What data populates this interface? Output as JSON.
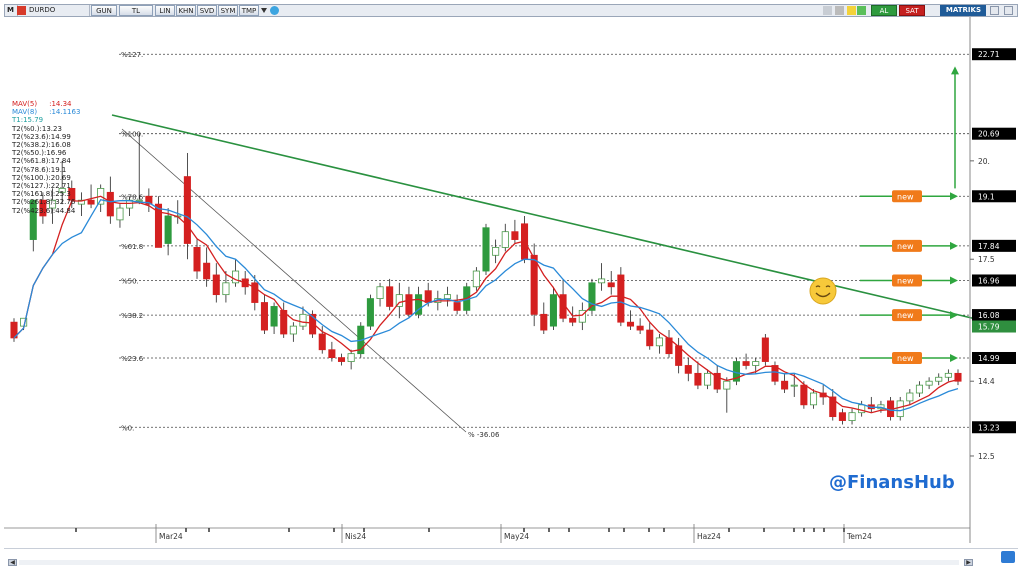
{
  "toolbar": {
    "app_letter": "M",
    "symbol": "DURDO",
    "buttons": [
      "GUN",
      "TL",
      "LIN",
      "KHN",
      "SVD",
      "SYM",
      "TMP"
    ],
    "buy_label": "AL",
    "sell_label": "SAT",
    "brand": "MATRIKS"
  },
  "indicators": [
    {
      "label": "MAV(5)",
      "value": ":14.34",
      "color": "#d42020"
    },
    {
      "label": "MAV(8)",
      "value": ":14.1163",
      "color": "#2a8ad8"
    },
    {
      "label": "T1:15.79",
      "value": "",
      "color": "#20a0a0"
    },
    {
      "label": "T2(%0.):13.23",
      "value": "",
      "color": "#222222"
    },
    {
      "label": "T2(%23.6):14.99",
      "value": "",
      "color": "#222222"
    },
    {
      "label": "T2(%38.2):16.08",
      "value": "",
      "color": "#222222"
    },
    {
      "label": "T2(%50.):16.96",
      "value": "",
      "color": "#222222"
    },
    {
      "label": "T2(%61.8):17.84",
      "value": "",
      "color": "#222222"
    },
    {
      "label": "T2(%78.6):19.1",
      "value": "",
      "color": "#222222"
    },
    {
      "label": "T2(%100.):20.69",
      "value": "",
      "color": "#222222"
    },
    {
      "label": "T2(%127.):22.71",
      "value": "",
      "color": "#222222"
    },
    {
      "label": "T2(%161.8):25.3",
      "value": "",
      "color": "#222222"
    },
    {
      "label": "T2(%261.8):32.76",
      "value": "",
      "color": "#222222"
    },
    {
      "label": "T2(%423.6):44.84",
      "value": "",
      "color": "#222222"
    }
  ],
  "fib_levels": [
    {
      "label": "%127.",
      "price": 22.71,
      "tag": "22.71"
    },
    {
      "label": "%100.",
      "price": 20.69,
      "tag": "20.69"
    },
    {
      "label": "%78.6",
      "price": 19.1,
      "tag": "19.1"
    },
    {
      "label": "%61.8",
      "price": 17.84,
      "tag": "17.84"
    },
    {
      "label": "%50.",
      "price": 16.96,
      "tag": "16.96"
    },
    {
      "label": "%38.2",
      "price": 16.08,
      "tag": "16.08"
    },
    {
      "label": "%23.6",
      "price": 14.99,
      "tag": "14.99"
    },
    {
      "label": "%0.",
      "price": 13.23,
      "tag": "13.23"
    }
  ],
  "y_axis_ticks": [
    {
      "price": 20.0,
      "label": "20."
    },
    {
      "price": 17.5,
      "label": "17.5"
    },
    {
      "price": 14.4,
      "label": "14.4"
    },
    {
      "price": 12.5,
      "label": "12.5"
    }
  ],
  "last_price": {
    "price": 15.79,
    "label": "15.79",
    "color": "#2f8f3f"
  },
  "new_badges": [
    {
      "price": 19.1,
      "label": "new"
    },
    {
      "price": 17.84,
      "label": "new"
    },
    {
      "price": 16.96,
      "label": "new"
    },
    {
      "price": 16.08,
      "label": "new"
    },
    {
      "price": 14.99,
      "label": "new"
    }
  ],
  "drawdown_label": "% -36.06",
  "x_axis_labels": [
    "Mar24",
    "Nis24",
    "May24",
    "Haz24",
    "Tem24"
  ],
  "watermark": "@FinansHub",
  "colors": {
    "up": "#2e9a3e",
    "down": "#d42020",
    "trend": "#2a9140",
    "ma5": "#d42020",
    "ma8": "#2a8ad8",
    "fib_line": "#555555",
    "arrow": "#2fa63f",
    "badge": "#f07a1a"
  },
  "chart_data": {
    "type": "candlestick",
    "x_labels": [
      "Mar24",
      "Nis24",
      "May24",
      "Haz24",
      "Tem24"
    ],
    "y_unit": "TL",
    "candles": [
      {
        "o": 15.9,
        "h": 16.0,
        "l": 15.4,
        "c": 15.5
      },
      {
        "o": 15.8,
        "h": 16.0,
        "l": 15.7,
        "c": 16.0
      },
      {
        "o": 18.0,
        "h": 19.0,
        "l": 17.7,
        "c": 19.0
      },
      {
        "o": 19.0,
        "h": 19.2,
        "l": 18.4,
        "c": 18.6
      },
      {
        "o": 18.8,
        "h": 19.3,
        "l": 18.4,
        "c": 19.0
      },
      {
        "o": 19.2,
        "h": 20.0,
        "l": 18.9,
        "c": 19.3
      },
      {
        "o": 19.3,
        "h": 19.5,
        "l": 18.8,
        "c": 19.0
      },
      {
        "o": 18.9,
        "h": 19.2,
        "l": 18.6,
        "c": 19.0
      },
      {
        "o": 19.0,
        "h": 19.4,
        "l": 18.8,
        "c": 18.9
      },
      {
        "o": 18.9,
        "h": 19.4,
        "l": 18.7,
        "c": 19.3
      },
      {
        "o": 19.2,
        "h": 19.6,
        "l": 18.4,
        "c": 18.6
      },
      {
        "o": 18.5,
        "h": 18.9,
        "l": 18.3,
        "c": 18.8
      },
      {
        "o": 18.8,
        "h": 19.1,
        "l": 18.6,
        "c": 19.0
      },
      {
        "o": 19.0,
        "h": 20.7,
        "l": 18.9,
        "c": 19.0
      },
      {
        "o": 19.1,
        "h": 19.3,
        "l": 18.7,
        "c": 18.9
      },
      {
        "o": 18.9,
        "h": 19.1,
        "l": 17.8,
        "c": 17.8
      },
      {
        "o": 17.9,
        "h": 18.8,
        "l": 17.6,
        "c": 18.6
      },
      {
        "o": 18.6,
        "h": 19.0,
        "l": 18.4,
        "c": 18.6
      },
      {
        "o": 19.6,
        "h": 20.2,
        "l": 17.5,
        "c": 17.9
      },
      {
        "o": 17.8,
        "h": 18.0,
        "l": 17.0,
        "c": 17.2
      },
      {
        "o": 17.4,
        "h": 17.8,
        "l": 16.8,
        "c": 17.0
      },
      {
        "o": 17.1,
        "h": 17.4,
        "l": 16.4,
        "c": 16.6
      },
      {
        "o": 16.6,
        "h": 17.2,
        "l": 16.4,
        "c": 16.9
      },
      {
        "o": 16.9,
        "h": 17.5,
        "l": 16.8,
        "c": 17.2
      },
      {
        "o": 17.0,
        "h": 17.2,
        "l": 16.6,
        "c": 16.8
      },
      {
        "o": 16.9,
        "h": 17.1,
        "l": 16.2,
        "c": 16.4
      },
      {
        "o": 16.4,
        "h": 16.6,
        "l": 15.6,
        "c": 15.7
      },
      {
        "o": 15.8,
        "h": 16.4,
        "l": 15.6,
        "c": 16.3
      },
      {
        "o": 16.2,
        "h": 16.4,
        "l": 15.5,
        "c": 15.6
      },
      {
        "o": 15.6,
        "h": 15.9,
        "l": 15.4,
        "c": 15.8
      },
      {
        "o": 15.8,
        "h": 16.3,
        "l": 15.7,
        "c": 16.1
      },
      {
        "o": 16.1,
        "h": 16.2,
        "l": 15.5,
        "c": 15.6
      },
      {
        "o": 15.6,
        "h": 15.8,
        "l": 15.1,
        "c": 15.2
      },
      {
        "o": 15.2,
        "h": 15.4,
        "l": 14.9,
        "c": 15.0
      },
      {
        "o": 15.0,
        "h": 15.1,
        "l": 14.8,
        "c": 14.9
      },
      {
        "o": 14.9,
        "h": 15.2,
        "l": 14.7,
        "c": 15.1
      },
      {
        "o": 15.1,
        "h": 15.9,
        "l": 15.0,
        "c": 15.8
      },
      {
        "o": 15.8,
        "h": 16.6,
        "l": 15.7,
        "c": 16.5
      },
      {
        "o": 16.5,
        "h": 16.9,
        "l": 16.3,
        "c": 16.8
      },
      {
        "o": 16.8,
        "h": 17.0,
        "l": 16.2,
        "c": 16.3
      },
      {
        "o": 16.3,
        "h": 16.9,
        "l": 16.0,
        "c": 16.6
      },
      {
        "o": 16.6,
        "h": 16.8,
        "l": 16.0,
        "c": 16.1
      },
      {
        "o": 16.1,
        "h": 16.8,
        "l": 16.0,
        "c": 16.6
      },
      {
        "o": 16.7,
        "h": 16.9,
        "l": 16.3,
        "c": 16.4
      },
      {
        "o": 16.4,
        "h": 16.7,
        "l": 16.2,
        "c": 16.5
      },
      {
        "o": 16.5,
        "h": 16.8,
        "l": 16.3,
        "c": 16.6
      },
      {
        "o": 16.4,
        "h": 16.6,
        "l": 16.1,
        "c": 16.2
      },
      {
        "o": 16.2,
        "h": 16.9,
        "l": 16.1,
        "c": 16.8
      },
      {
        "o": 16.8,
        "h": 17.3,
        "l": 16.7,
        "c": 17.2
      },
      {
        "o": 17.2,
        "h": 18.4,
        "l": 17.1,
        "c": 18.3
      },
      {
        "o": 17.6,
        "h": 18.0,
        "l": 17.4,
        "c": 17.8
      },
      {
        "o": 17.8,
        "h": 18.4,
        "l": 17.7,
        "c": 18.2
      },
      {
        "o": 18.2,
        "h": 18.5,
        "l": 17.9,
        "c": 18.0
      },
      {
        "o": 18.4,
        "h": 18.6,
        "l": 17.4,
        "c": 17.5
      },
      {
        "o": 17.6,
        "h": 17.9,
        "l": 15.8,
        "c": 16.1
      },
      {
        "o": 16.1,
        "h": 16.4,
        "l": 15.6,
        "c": 15.7
      },
      {
        "o": 15.8,
        "h": 16.8,
        "l": 15.7,
        "c": 16.6
      },
      {
        "o": 16.6,
        "h": 17.0,
        "l": 15.9,
        "c": 16.0
      },
      {
        "o": 16.0,
        "h": 16.3,
        "l": 15.8,
        "c": 15.9
      },
      {
        "o": 15.9,
        "h": 16.4,
        "l": 15.7,
        "c": 16.2
      },
      {
        "o": 16.2,
        "h": 17.0,
        "l": 16.1,
        "c": 16.9
      },
      {
        "o": 16.9,
        "h": 17.4,
        "l": 16.7,
        "c": 17.0
      },
      {
        "o": 16.9,
        "h": 17.2,
        "l": 16.6,
        "c": 16.8
      },
      {
        "o": 17.1,
        "h": 17.3,
        "l": 15.8,
        "c": 15.9
      },
      {
        "o": 15.9,
        "h": 16.2,
        "l": 15.7,
        "c": 15.8
      },
      {
        "o": 15.8,
        "h": 16.0,
        "l": 15.6,
        "c": 15.7
      },
      {
        "o": 15.7,
        "h": 15.9,
        "l": 15.2,
        "c": 15.3
      },
      {
        "o": 15.3,
        "h": 15.6,
        "l": 15.1,
        "c": 15.5
      },
      {
        "o": 15.5,
        "h": 15.7,
        "l": 15.0,
        "c": 15.1
      },
      {
        "o": 15.3,
        "h": 15.5,
        "l": 14.6,
        "c": 14.8
      },
      {
        "o": 14.8,
        "h": 15.0,
        "l": 14.4,
        "c": 14.6
      },
      {
        "o": 14.6,
        "h": 14.9,
        "l": 14.2,
        "c": 14.3
      },
      {
        "o": 14.3,
        "h": 14.7,
        "l": 14.2,
        "c": 14.6
      },
      {
        "o": 14.6,
        "h": 14.8,
        "l": 14.1,
        "c": 14.2
      },
      {
        "o": 14.2,
        "h": 14.5,
        "l": 13.6,
        "c": 14.4
      },
      {
        "o": 14.4,
        "h": 15.0,
        "l": 14.3,
        "c": 14.9
      },
      {
        "o": 14.9,
        "h": 15.1,
        "l": 14.7,
        "c": 14.8
      },
      {
        "o": 14.8,
        "h": 15.0,
        "l": 14.6,
        "c": 14.9
      },
      {
        "o": 15.5,
        "h": 15.6,
        "l": 14.8,
        "c": 14.9
      },
      {
        "o": 14.8,
        "h": 14.9,
        "l": 14.3,
        "c": 14.4
      },
      {
        "o": 14.4,
        "h": 14.6,
        "l": 14.1,
        "c": 14.2
      },
      {
        "o": 14.3,
        "h": 14.6,
        "l": 14.0,
        "c": 14.3
      },
      {
        "o": 14.3,
        "h": 14.4,
        "l": 13.7,
        "c": 13.8
      },
      {
        "o": 13.8,
        "h": 14.2,
        "l": 13.7,
        "c": 14.1
      },
      {
        "o": 14.1,
        "h": 14.3,
        "l": 13.8,
        "c": 14.0
      },
      {
        "o": 14.0,
        "h": 14.2,
        "l": 13.4,
        "c": 13.5
      },
      {
        "o": 13.6,
        "h": 13.7,
        "l": 13.3,
        "c": 13.4
      },
      {
        "o": 13.4,
        "h": 13.7,
        "l": 13.3,
        "c": 13.6
      },
      {
        "o": 13.6,
        "h": 13.9,
        "l": 13.5,
        "c": 13.8
      },
      {
        "o": 13.8,
        "h": 14.0,
        "l": 13.6,
        "c": 13.7
      },
      {
        "o": 13.7,
        "h": 13.9,
        "l": 13.6,
        "c": 13.8
      },
      {
        "o": 13.9,
        "h": 14.0,
        "l": 13.4,
        "c": 13.5
      },
      {
        "o": 13.5,
        "h": 14.0,
        "l": 13.4,
        "c": 13.9
      },
      {
        "o": 13.9,
        "h": 14.2,
        "l": 13.8,
        "c": 14.1
      },
      {
        "o": 14.1,
        "h": 14.4,
        "l": 14.0,
        "c": 14.3
      },
      {
        "o": 14.3,
        "h": 14.5,
        "l": 14.2,
        "c": 14.4
      },
      {
        "o": 14.4,
        "h": 14.6,
        "l": 14.3,
        "c": 14.5
      },
      {
        "o": 14.5,
        "h": 14.7,
        "l": 14.4,
        "c": 14.6
      },
      {
        "o": 14.6,
        "h": 14.7,
        "l": 14.3,
        "c": 14.4
      }
    ]
  }
}
